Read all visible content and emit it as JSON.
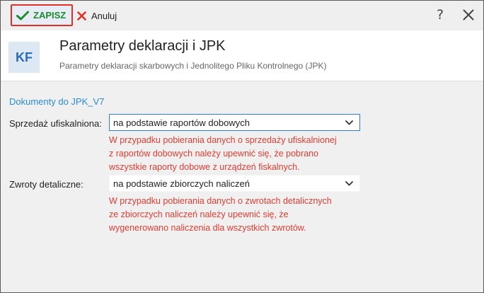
{
  "toolbar": {
    "save_label": "ZAPISZ",
    "cancel_label": "Anuluj",
    "help_label": "?"
  },
  "header": {
    "badge": "KF",
    "title": "Parametry deklaracji i JPK",
    "subtitle": "Parametry deklaracji skarbowych i Jednolitego Pliku Kontrolnego (JPK)"
  },
  "section": {
    "title": "Dokumenty do JPK_V7"
  },
  "fields": [
    {
      "label": "Sprzedaż ufiskalniona:",
      "value": "na podstawie raportów dobowych",
      "warning_lines": [
        "W przypadku pobierania danych o sprzedaży ufiskalnionej",
        "z raportów dobowych należy upewnić się, że pobrano",
        "wszystkie raporty dobowe z urządzeń fiskalnych."
      ]
    },
    {
      "label": "Zwroty detaliczne:",
      "value": "na podstawie zbiorczych naliczeń",
      "warning_lines": [
        "W przypadku pobierania danych o zwrotach detalicznych",
        "ze zbiorczych naliczeń należy upewnić się, że",
        "wygenerowano naliczenia dla wszystkich zwrotów."
      ]
    }
  ],
  "icons": {
    "save": "checkmark-icon",
    "cancel": "x-icon",
    "close": "close-icon",
    "dropdown": "chevron-down-icon"
  },
  "colors": {
    "save_green": "#1e8a2d",
    "cancel_red": "#e0302a",
    "warning_red": "#e03c32",
    "accent_blue": "#2a8bd0",
    "badge_bg": "#dde8f5"
  }
}
